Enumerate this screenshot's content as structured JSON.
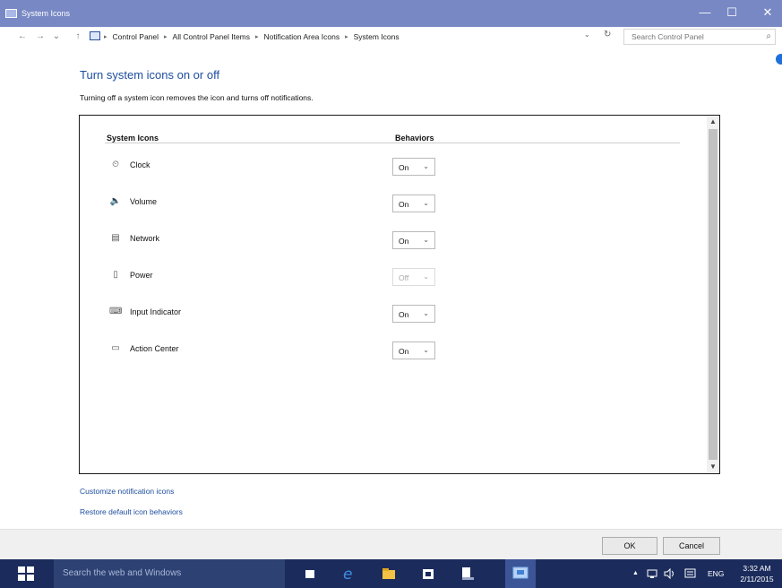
{
  "window": {
    "title": "System Icons",
    "controls": {
      "minimize": "—",
      "maximize": "☐",
      "close": "✕"
    }
  },
  "addressbar": {
    "back": "←",
    "forward": "→",
    "recent": "⌄",
    "up": "↑",
    "breadcrumbs": [
      "Control Panel",
      "All Control Panel Items",
      "Notification Area Icons",
      "System Icons"
    ],
    "separator": "▸",
    "dropdown": "⌄",
    "refresh": "↻",
    "search_placeholder": "Search Control Panel",
    "search_icon": "⌕"
  },
  "main": {
    "title": "Turn system icons on or off",
    "description": "Turning off a system icon removes the icon and turns off notifications.",
    "columns": {
      "icons": "System Icons",
      "behaviors": "Behaviors"
    },
    "rows": [
      {
        "icon": "clock-icon",
        "glyph": "⏲",
        "label": "Clock",
        "value": "On",
        "disabled": false
      },
      {
        "icon": "volume-icon",
        "glyph": "🔈",
        "label": "Volume",
        "value": "On",
        "disabled": false
      },
      {
        "icon": "network-icon",
        "glyph": "▤",
        "label": "Network",
        "value": "On",
        "disabled": false
      },
      {
        "icon": "power-icon",
        "glyph": "▯",
        "label": "Power",
        "value": "Off",
        "disabled": true
      },
      {
        "icon": "input-indicator-icon",
        "glyph": "⌨",
        "label": "Input Indicator",
        "value": "On",
        "disabled": false
      },
      {
        "icon": "action-center-icon",
        "glyph": "▭",
        "label": "Action Center",
        "value": "On",
        "disabled": false
      }
    ],
    "select_chevron": "⌄",
    "scroll_up": "▲",
    "scroll_down": "▼",
    "links": {
      "customize": "Customize notification icons",
      "restore": "Restore default icon behaviors"
    }
  },
  "footer": {
    "ok": "OK",
    "cancel": "Cancel"
  },
  "taskbar": {
    "search_placeholder": "Search the web and Windows",
    "tray_arrow": "▲",
    "language": "ENG",
    "time": "3:32 AM",
    "date": "2/11/2015"
  },
  "colors": {
    "accent": "#1e4ea0",
    "titlebar": "#7788c4",
    "taskbar": "#1b2c5c"
  }
}
